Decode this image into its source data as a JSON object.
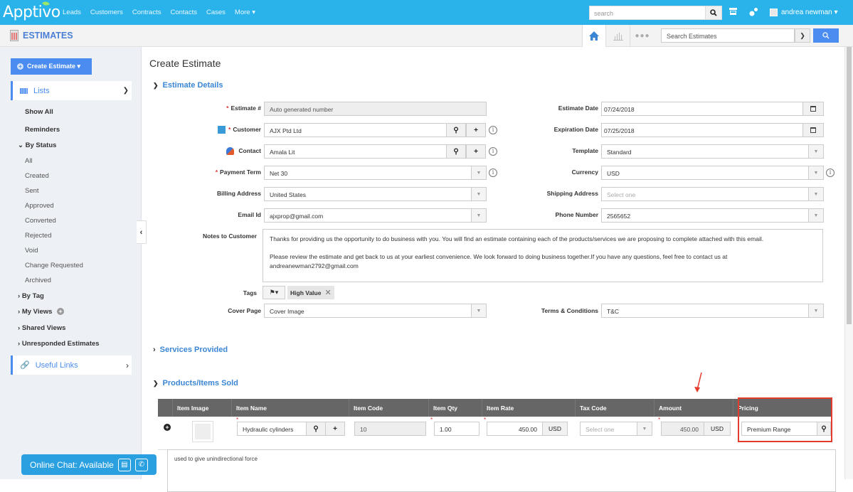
{
  "topbar": {
    "logo": "Apptivo",
    "nav": [
      "Leads",
      "Customers",
      "Contracts",
      "Contacts",
      "Cases",
      "More ▾"
    ],
    "search_placeholder": "search",
    "user_name": "andrea newman ▾"
  },
  "subbar": {
    "app_title": "ESTIMATES",
    "search_placeholder": "Search Estimates"
  },
  "sidebar": {
    "create_button": "Create Estimate ▾",
    "lists_label": "Lists",
    "show_all": "Show All",
    "reminders": "Reminders",
    "by_status": "By Status",
    "statuses": [
      "All",
      "Created",
      "Sent",
      "Approved",
      "Converted",
      "Rejected",
      "Void",
      "Change Requested",
      "Archived"
    ],
    "by_tag": "By Tag",
    "my_views": "My Views",
    "shared_views": "Shared Views",
    "unresponded": "Unresponded Estimates",
    "useful_links": "Useful Links"
  },
  "chat": {
    "label": "Online Chat: Available"
  },
  "main": {
    "page_title": "Create Estimate",
    "sections": {
      "estimate_details": "Estimate Details",
      "services_provided": "Services Provided",
      "products_sold": "Products/Items Sold"
    },
    "left_fields": {
      "estimate_no": {
        "label": "Estimate #",
        "value": "Auto generated number"
      },
      "customer": {
        "label": "Customer",
        "value": "AJX Ptd Ltd"
      },
      "contact": {
        "label": "Contact",
        "value": "Amala Lit"
      },
      "payment_term": {
        "label": "Payment Term",
        "value": "Net 30"
      },
      "billing_address": {
        "label": "Billing Address",
        "value": "United States"
      },
      "email_id": {
        "label": "Email Id",
        "value": "ajxprop@gmail.com"
      }
    },
    "right_fields": {
      "estimate_date": {
        "label": "Estimate Date",
        "value": "07/24/2018"
      },
      "expiration_date": {
        "label": "Expiration Date",
        "value": "07/25/2018"
      },
      "template": {
        "label": "Template",
        "value": "Standard"
      },
      "currency": {
        "label": "Currency",
        "value": "USD"
      },
      "shipping_address": {
        "label": "Shipping Address",
        "placeholder": "Select one"
      },
      "phone_number": {
        "label": "Phone Number",
        "value": "2565652"
      }
    },
    "notes": {
      "label": "Notes to Customer",
      "line1": "Thanks for providing us the opportunity to do business with you. You will find an estimate containing each of the products/services we are proposing to complete attached with this email.",
      "line2": "Please review the estimate and get back to us at your earliest convenience. We look forward to doing business together.If you have any questions, feel free to contact us at",
      "line3": "andreanewman2792@gmail.com"
    },
    "tags": {
      "label": "Tags",
      "chip": "High Value"
    },
    "cover_page": {
      "label": "Cover Page",
      "value": "Cover Image"
    },
    "terms": {
      "label": "Terms & Conditions",
      "value": "T&C"
    },
    "items_table": {
      "headers": [
        "",
        "Item Image",
        "Item Name",
        "Item Code",
        "Item Qty",
        "Item Rate",
        "Tax Code",
        "Amount",
        "Pricing"
      ],
      "row": {
        "item_name": "Hydraulic cylinders",
        "item_code": "10",
        "qty": "1.00",
        "rate": "450.00",
        "rate_currency": "USD",
        "tax_code_placeholder": "Select one",
        "amount": "450.00",
        "amount_currency": "USD",
        "pricing": "Premium Range",
        "description": "used to give unindirectional force"
      }
    }
  }
}
